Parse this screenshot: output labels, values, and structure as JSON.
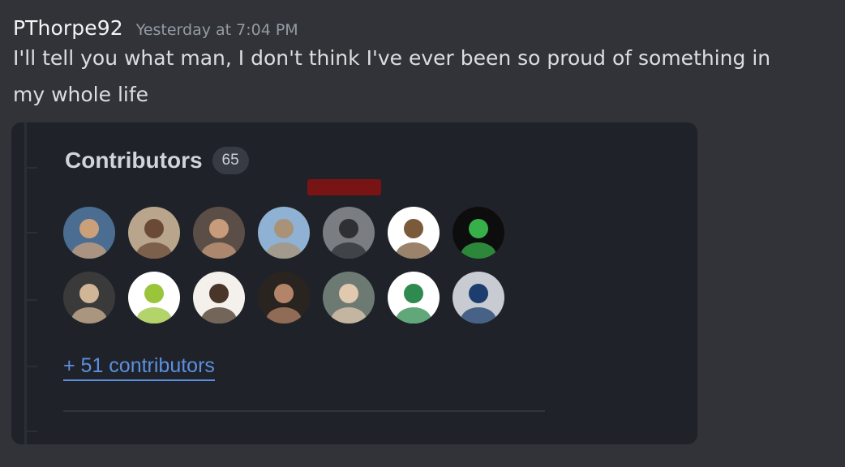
{
  "message": {
    "username": "PThorpe92",
    "timestamp": "Yesterday at 7:04 PM",
    "text": "I'll tell you what man, I don't think I've ever been so proud of something in my whole life"
  },
  "embed": {
    "title": "Contributors",
    "count": "65",
    "more_link": "+ 51 contributors",
    "avatar_rows": [
      [
        {
          "name": "contributor-avatar-1",
          "bg": "#4b6d92",
          "fg": "#c9a07a"
        },
        {
          "name": "contributor-avatar-2",
          "bg": "#b9a58c",
          "fg": "#6a4a36"
        },
        {
          "name": "contributor-avatar-3",
          "bg": "#5a4e46",
          "fg": "#c89b7b"
        },
        {
          "name": "contributor-avatar-4",
          "bg": "#8fb2d4",
          "fg": "#a99277"
        },
        {
          "name": "contributor-avatar-5",
          "bg": "#7a7d82",
          "fg": "#2e3034"
        },
        {
          "name": "contributor-avatar-6",
          "bg": "#ffffff",
          "fg": "#7a5a3a"
        },
        {
          "name": "contributor-avatar-7",
          "bg": "#0d0d0d",
          "fg": "#38b04a"
        }
      ],
      [
        {
          "name": "contributor-avatar-8",
          "bg": "#3a3a3a",
          "fg": "#d0b597"
        },
        {
          "name": "contributor-avatar-9",
          "bg": "#ffffff",
          "fg": "#9ac43a"
        },
        {
          "name": "contributor-avatar-10",
          "bg": "#f4f1ec",
          "fg": "#4a3628"
        },
        {
          "name": "contributor-avatar-11",
          "bg": "#2a2420",
          "fg": "#b38468"
        },
        {
          "name": "contributor-avatar-12",
          "bg": "#6d7a73",
          "fg": "#e0c9ae"
        },
        {
          "name": "contributor-avatar-13",
          "bg": "#ffffff",
          "fg": "#2e8a4e"
        },
        {
          "name": "contributor-avatar-14",
          "bg": "#c8ccd2",
          "fg": "#1d3d6e"
        }
      ]
    ]
  },
  "colors": {
    "background": "#313338",
    "embed_bg": "#1f2329",
    "link": "#5c8fe0"
  }
}
